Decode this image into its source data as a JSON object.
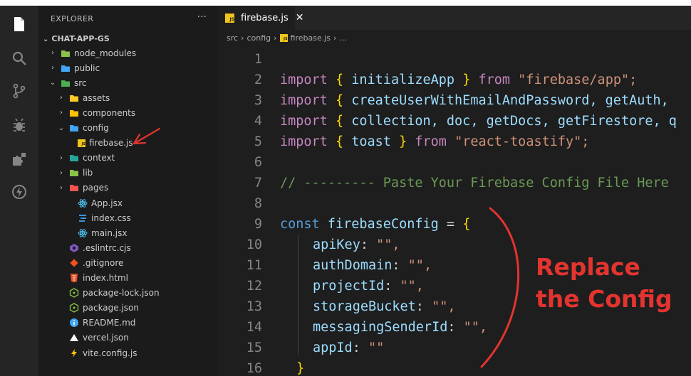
{
  "sidebar": {
    "title": "EXPLORER",
    "more": "···",
    "project": "CHAT-APP-GS",
    "items": [
      {
        "label": "node_modules",
        "chev": "›",
        "depth": 1,
        "icon": "folder-icon",
        "color": "#8bc34a"
      },
      {
        "label": "public",
        "chev": "›",
        "depth": 1,
        "icon": "folder-icon",
        "color": "#42a5f5"
      },
      {
        "label": "src",
        "chev": "⌄",
        "depth": 1,
        "icon": "folder-open-icon",
        "color": "#4caf50"
      },
      {
        "label": "assets",
        "chev": "›",
        "depth": 2,
        "icon": "folder-icon",
        "color": "#ffca28"
      },
      {
        "label": "components",
        "chev": "›",
        "depth": 2,
        "icon": "folder-icon",
        "color": "#ffc107"
      },
      {
        "label": "config",
        "chev": "⌄",
        "depth": 2,
        "icon": "folder-open-icon",
        "color": "#42a5f5"
      },
      {
        "label": "firebase.js",
        "chev": "",
        "depth": 3,
        "icon": "js-file-icon",
        "color": "#f0c419"
      },
      {
        "label": "context",
        "chev": "›",
        "depth": 2,
        "icon": "folder-icon",
        "color": "#26a69a"
      },
      {
        "label": "lib",
        "chev": "›",
        "depth": 2,
        "icon": "folder-icon",
        "color": "#8bc34a"
      },
      {
        "label": "pages",
        "chev": "›",
        "depth": 2,
        "icon": "folder-icon",
        "color": "#ef5350"
      },
      {
        "label": "App.jsx",
        "chev": "",
        "depth": 3,
        "icon": "react-icon",
        "color": "#4fc3f7"
      },
      {
        "label": "index.css",
        "chev": "",
        "depth": 3,
        "icon": "css-icon",
        "color": "#42a5f5"
      },
      {
        "label": "main.jsx",
        "chev": "",
        "depth": 3,
        "icon": "react-icon",
        "color": "#4fc3f7"
      },
      {
        "label": ".eslintrc.cjs",
        "chev": "",
        "depth": 2,
        "icon": "eslint-icon",
        "color": "#7e57c2"
      },
      {
        "label": ".gitignore",
        "chev": "",
        "depth": 2,
        "icon": "git-icon",
        "color": "#f4511e"
      },
      {
        "label": "index.html",
        "chev": "",
        "depth": 2,
        "icon": "html-icon",
        "color": "#e44d26"
      },
      {
        "label": "package-lock.json",
        "chev": "",
        "depth": 2,
        "icon": "npm-icon",
        "color": "#8bc34a"
      },
      {
        "label": "package.json",
        "chev": "",
        "depth": 2,
        "icon": "npm-icon",
        "color": "#8bc34a"
      },
      {
        "label": "README.md",
        "chev": "",
        "depth": 2,
        "icon": "info-icon",
        "color": "#42a5f5"
      },
      {
        "label": "vercel.json",
        "chev": "",
        "depth": 2,
        "icon": "vercel-icon",
        "color": "#ffffff"
      },
      {
        "label": "vite.config.js",
        "chev": "",
        "depth": 2,
        "icon": "vite-icon",
        "color": "#ffc107"
      }
    ]
  },
  "tab": {
    "label": "firebase.js",
    "close": "✕"
  },
  "breadcrumb": [
    "src",
    "›",
    "config",
    "›",
    "firebase.js",
    "›",
    "..."
  ],
  "code": {
    "line_numbers": [
      "1",
      "2",
      "3",
      "4",
      "5",
      "6",
      "7",
      "8",
      "9",
      "10",
      "11",
      "12",
      "13",
      "14",
      "15",
      "16"
    ],
    "l2": [
      "import",
      "{",
      "initializeApp",
      "}",
      "from",
      "\"firebase/app\";"
    ],
    "l3": [
      "import",
      "{",
      "createUserWithEmailAndPassword, getAuth,"
    ],
    "l4": [
      "import",
      "{",
      "collection, doc, getDocs, getFirestore, q"
    ],
    "l5": [
      "import",
      "{",
      "toast",
      "}",
      "from",
      "\"react-toastify\";"
    ],
    "l7": "// --------- Paste Your Firebase Config File Here",
    "l9": [
      "const",
      "firebaseConfig",
      "=",
      "{"
    ],
    "props": [
      {
        "key": "apiKey",
        "val": "\"\","
      },
      {
        "key": "authDomain",
        "val": "\"\","
      },
      {
        "key": "projectId",
        "val": "\"\","
      },
      {
        "key": "storageBucket",
        "val": "\"\","
      },
      {
        "key": "messagingSenderId",
        "val": "\"\","
      },
      {
        "key": "appId",
        "val": "\"\""
      }
    ],
    "l16": "}"
  },
  "annotation": {
    "line1": "Replace",
    "line2": "the Config",
    "color": "#e3342f"
  }
}
